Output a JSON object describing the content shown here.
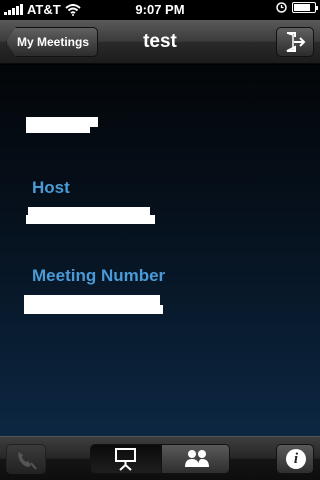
{
  "status_bar": {
    "carrier": "AT&T",
    "time": "9:07 PM"
  },
  "nav": {
    "back_label": "My Meetings",
    "title": "test"
  },
  "details": {
    "host_label": "Host",
    "meeting_number_label": "Meeting Number"
  },
  "toolbar": {
    "info_glyph": "i"
  },
  "colors": {
    "label_blue": "#4a9ad6"
  }
}
